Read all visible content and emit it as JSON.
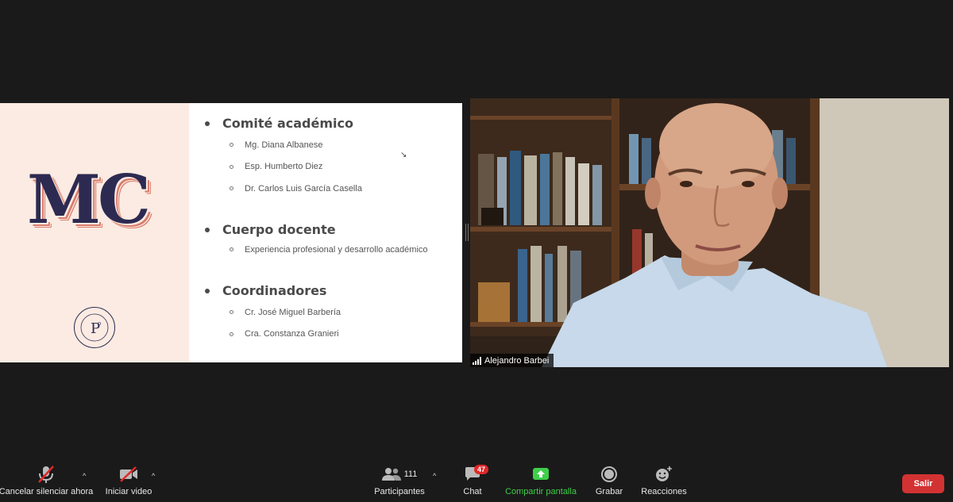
{
  "slide": {
    "logo_text": "MC",
    "sections": [
      {
        "title": "Comité académico",
        "items": [
          "Mg. Diana Albanese",
          "Esp. Humberto Diez",
          "Dr. Carlos Luis García Casella"
        ]
      },
      {
        "title": "Cuerpo docente",
        "items": [
          "Experiencia profesional y desarrollo académico"
        ]
      },
      {
        "title": "Coordinadores",
        "items": [
          "Cr. José Miguel Barbería",
          "Cra. Constanza Granieri"
        ]
      }
    ]
  },
  "video": {
    "participant_name": "Alejandro Barbei"
  },
  "toolbar": {
    "audio_label": "Cancelar silenciar ahora",
    "video_label": "Iniciar video",
    "participants_label": "Participantes",
    "participants_count": "111",
    "chat_label": "Chat",
    "chat_badge": "47",
    "share_label": "Compartir pantalla",
    "record_label": "Grabar",
    "reactions_label": "Reacciones",
    "leave_label": "Salir",
    "share_color": "#3ecf4a",
    "leave_color": "#d23232"
  }
}
